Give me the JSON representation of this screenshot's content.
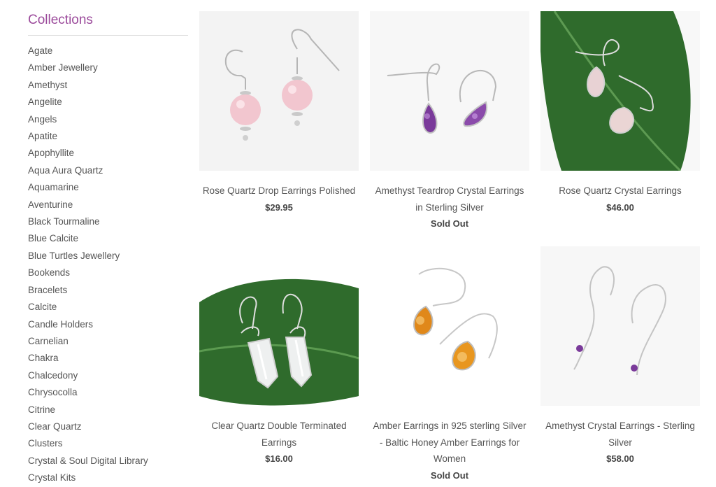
{
  "sidebar": {
    "heading": "Collections",
    "items": [
      "Agate",
      "Amber Jewellery",
      "Amethyst",
      "Angelite",
      "Angels",
      "Apatite",
      "Apophyllite",
      "Aqua Aura Quartz",
      "Aquamarine",
      "Aventurine",
      "Black Tourmaline",
      "Blue Calcite",
      "Blue Turtles Jewellery",
      "Bookends",
      "Bracelets",
      "Calcite",
      "Candle Holders",
      "Carnelian",
      "Chakra",
      "Chalcedony",
      "Chrysocolla",
      "Citrine",
      "Clear Quartz",
      "Clusters",
      "Crystal & Soul Digital Library",
      "Crystal Kits"
    ]
  },
  "products": [
    {
      "title": "Rose Quartz Drop Earrings Polished",
      "price": "$29.95"
    },
    {
      "title": "Amethyst Teardrop Crystal Earrings in Sterling Silver",
      "price": "Sold Out"
    },
    {
      "title": "Rose Quartz Crystal Earrings",
      "price": "$46.00"
    },
    {
      "title": "Clear Quartz Double Terminated Earrings",
      "price": "$16.00"
    },
    {
      "title": "Amber Earrings in 925 sterling Silver - Baltic Honey Amber Earrings for Women",
      "price": "Sold Out"
    },
    {
      "title": "Amethyst Crystal Earrings - Sterling Silver",
      "price": "$58.00"
    }
  ],
  "colors": {
    "heading": "#9b4a9b",
    "leaf": "#2f6b2c",
    "rose_quartz": "#f2c6cf",
    "amethyst": "#7a3a9a",
    "amber": "#e0881a",
    "silver": "#b8b8b8"
  }
}
